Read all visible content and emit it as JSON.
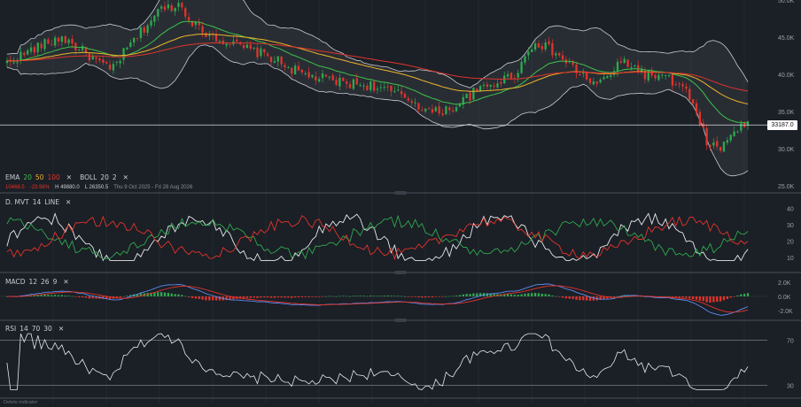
{
  "chart_data": {
    "type": "candlestick",
    "x_range": [
      "Thu 9 Oct 2025",
      "Fri 28 Aug 2026"
    ],
    "price_axis": {
      "ticks": [
        "50.0K",
        "45.0K",
        "40.0K",
        "35.0K",
        "30.0K",
        "25.0K"
      ],
      "ylim": [
        25000,
        50000
      ]
    },
    "last_price": "33187.0",
    "indicators_legend": {
      "ema": {
        "name": "EMA",
        "periods": [
          "20",
          "50",
          "100"
        ]
      },
      "boll": {
        "name": "BOLL",
        "params": [
          "20",
          "2"
        ]
      }
    },
    "stats": {
      "change": "10468.5",
      "change_pct": "-23.98%",
      "high": "H 49880.0",
      "low": "L 26350.5",
      "range": "Thu 9 Oct 2025 - Fri 28 Aug 2026"
    },
    "dmi": {
      "label": "D. MVT",
      "period": "14",
      "style": "LINE",
      "ticks": [
        "40",
        "30",
        "20",
        "10"
      ],
      "ylim": [
        5,
        45
      ]
    },
    "macd": {
      "label": "MACD",
      "params": [
        "12",
        "26",
        "9"
      ],
      "ticks": [
        "2.0K",
        "0.0K",
        "-2.0K"
      ],
      "ylim": [
        -2600,
        2600
      ]
    },
    "rsi": {
      "label": "RSI",
      "params": [
        "14",
        "70",
        "30"
      ],
      "ticks": [
        "70",
        "30"
      ],
      "ylim": [
        20,
        80
      ]
    },
    "price_anchors": [
      [
        0,
        41500
      ],
      [
        8,
        43500
      ],
      [
        16,
        45000
      ],
      [
        24,
        42500
      ],
      [
        30,
        40500
      ],
      [
        36,
        44000
      ],
      [
        44,
        48500
      ],
      [
        50,
        49500
      ],
      [
        56,
        46000
      ],
      [
        66,
        44000
      ],
      [
        76,
        42500
      ],
      [
        86,
        40000
      ],
      [
        96,
        39000
      ],
      [
        106,
        38500
      ],
      [
        116,
        37000
      ],
      [
        124,
        34800
      ],
      [
        130,
        35500
      ],
      [
        136,
        37500
      ],
      [
        142,
        38800
      ],
      [
        148,
        40000
      ],
      [
        154,
        44500
      ],
      [
        160,
        42800
      ],
      [
        166,
        40500
      ],
      [
        172,
        38500
      ],
      [
        180,
        41800
      ],
      [
        186,
        40000
      ],
      [
        192,
        39500
      ],
      [
        198,
        37800
      ],
      [
        204,
        31000
      ],
      [
        208,
        29800
      ],
      [
        212,
        32500
      ],
      [
        216,
        33200
      ]
    ],
    "colors": {
      "background": "#1b1f26",
      "up": "#2fa84f",
      "down": "#e0342b",
      "ema20": "#3ec14a",
      "ema50": "#f0b429",
      "ema100": "#e0342b",
      "boll": "#c8ccd3",
      "dmi_adx": "#e6e8eb",
      "dmi_plus": "#2fa84f",
      "dmi_minus": "#e0342b",
      "macd": "#5b8def",
      "signal": "#e0342b",
      "rsi": "#e6e8eb"
    }
  },
  "footer": {
    "note": "Delete indicator"
  }
}
